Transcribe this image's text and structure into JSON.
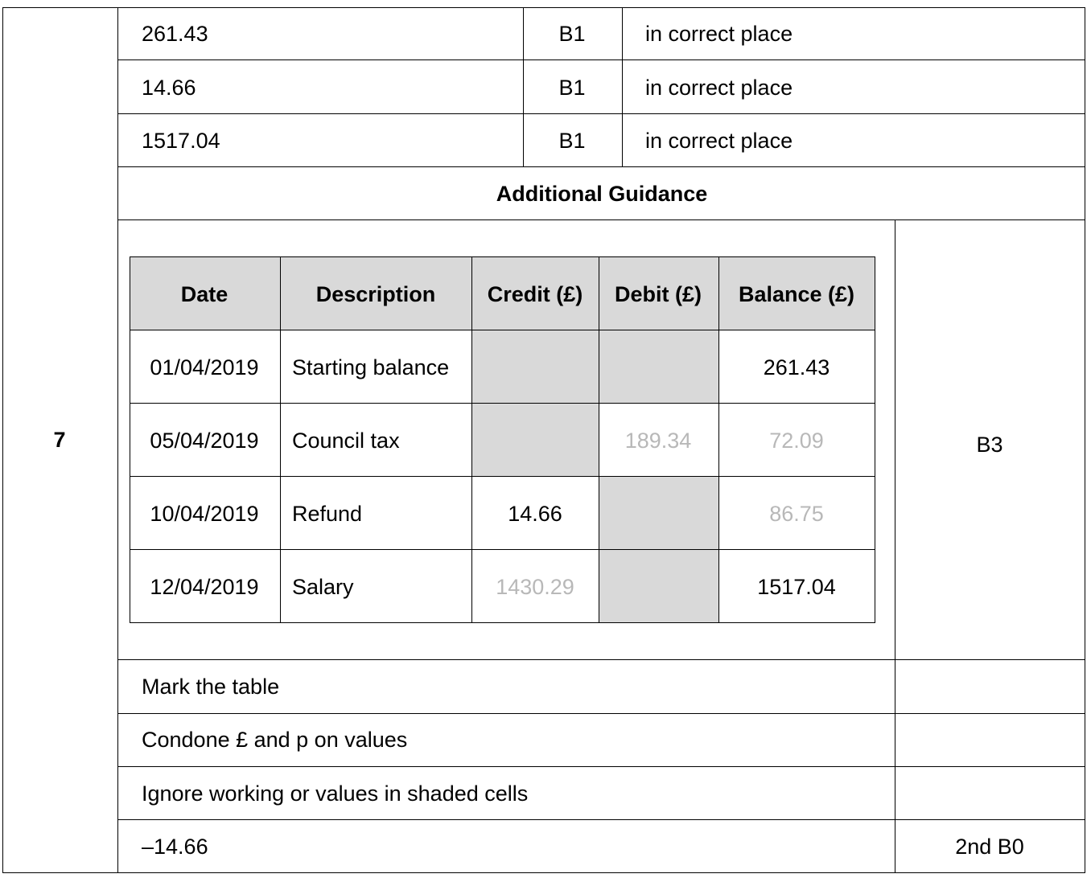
{
  "question_number": "7",
  "mark_rows": [
    {
      "answer": "261.43",
      "mark": "B1",
      "comment": "in correct place"
    },
    {
      "answer": "14.66",
      "mark": "B1",
      "comment": "in correct place"
    },
    {
      "answer": "1517.04",
      "mark": "B1",
      "comment": "in correct place"
    }
  ],
  "guidance_heading": "Additional Guidance",
  "statement": {
    "headers": [
      "Date",
      "Description",
      "Credit (£)",
      "Debit (£)",
      "Balance (£)"
    ],
    "rows": [
      {
        "date": "01/04/2019",
        "description": "Starting balance",
        "credit": "",
        "debit": "",
        "balance": "261.43",
        "shaded": [
          "credit",
          "debit"
        ],
        "faint": []
      },
      {
        "date": "05/04/2019",
        "description": "Council tax",
        "credit": "",
        "debit": "189.34",
        "balance": "72.09",
        "shaded": [
          "credit"
        ],
        "faint": [
          "debit",
          "balance"
        ]
      },
      {
        "date": "10/04/2019",
        "description": "Refund",
        "credit": "14.66",
        "debit": "",
        "balance": "86.75",
        "shaded": [
          "debit"
        ],
        "faint": [
          "balance"
        ]
      },
      {
        "date": "12/04/2019",
        "description": "Salary",
        "credit": "1430.29",
        "debit": "",
        "balance": "1517.04",
        "shaded": [
          "debit"
        ],
        "faint": [
          "credit"
        ]
      }
    ]
  },
  "table_mark": "B3",
  "guidance_rows": [
    {
      "text": "Mark the table",
      "mark": ""
    },
    {
      "text": "Condone £ and p on values",
      "mark": ""
    },
    {
      "text": "Ignore working or values in shaded cells",
      "mark": ""
    },
    {
      "text": "–14.66",
      "mark": "2nd B0"
    }
  ],
  "colors": {
    "shade": "#d9d9d9",
    "faint_text": "#b8b8b8",
    "rule": "#000000"
  }
}
